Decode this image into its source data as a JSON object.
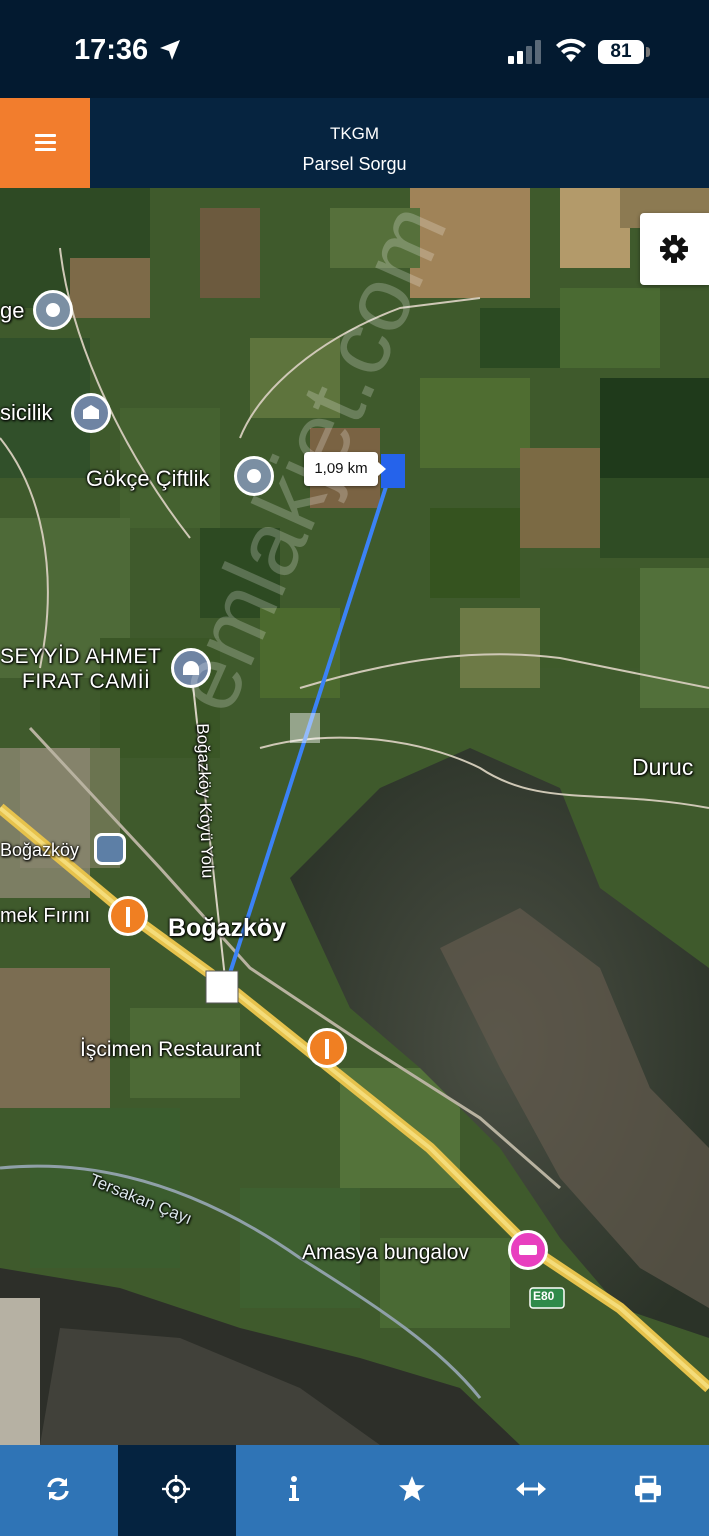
{
  "status_bar": {
    "time": "17:36",
    "battery": "81"
  },
  "header": {
    "title": "TKGM",
    "subtitle": "Parsel Sorgu"
  },
  "map": {
    "distance_label": "1,09 km",
    "watermark": "emlakjet.com",
    "labels": {
      "ge": "ge",
      "sicilik": "sicilik",
      "gokce": "Gökçe Çiftlik",
      "camii_1": "SEYYİD AHMET",
      "camii_2": "FIRAT CAMİİ",
      "road": "Boğazköy Köyü Yolu",
      "durucu": "Duruc",
      "bogazkoy_station": "Boğazköy",
      "firin": "mek Fırını",
      "bogazkoy": "Boğazköy",
      "restaurant": "İşcimen Restaurant",
      "river": "Tersakan Çayı",
      "bungalov": "Amasya bungalov",
      "e80": "E80"
    }
  },
  "toolbar": {
    "items": [
      "refresh-icon",
      "locate-icon",
      "info-icon",
      "star-icon",
      "measure-icon",
      "print-icon"
    ],
    "active": "locate-icon"
  }
}
